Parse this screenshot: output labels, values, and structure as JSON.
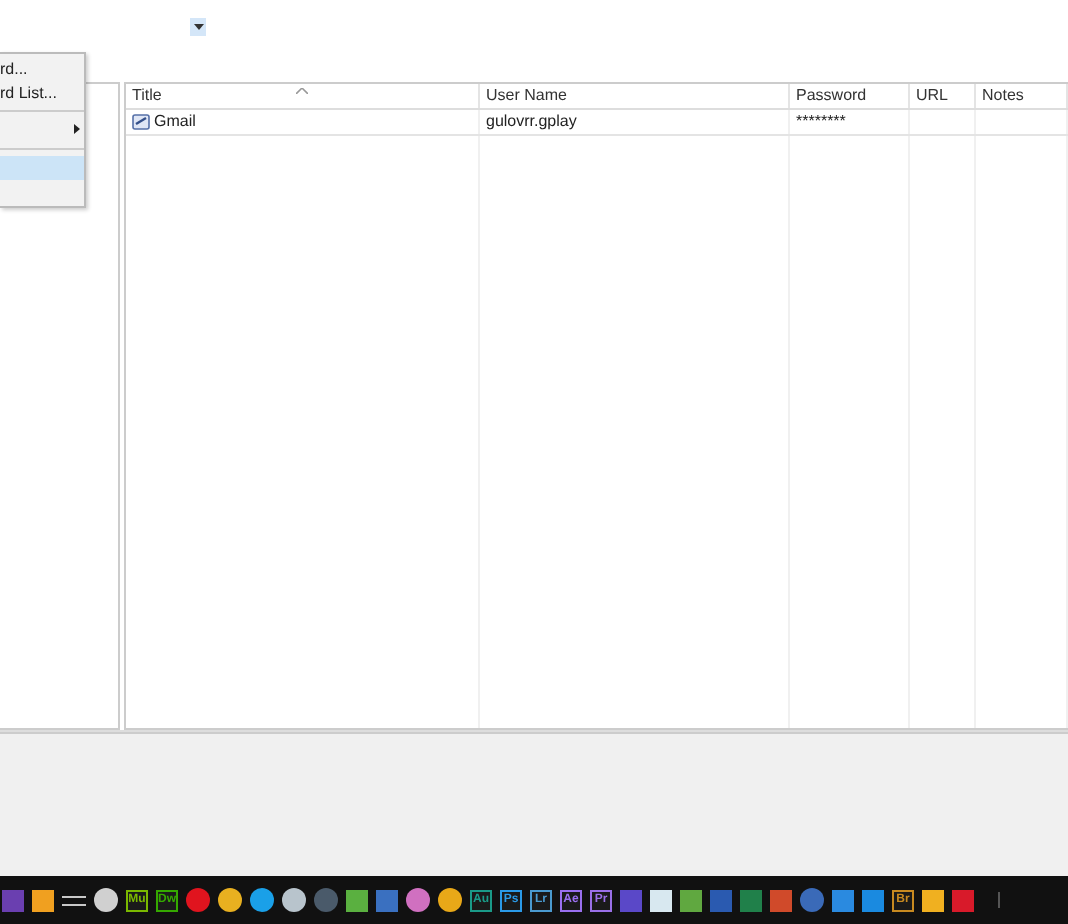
{
  "menu": {
    "items": [
      {
        "kind": "item",
        "label": "rd...",
        "selected": false
      },
      {
        "kind": "item",
        "label": "rd List...",
        "selected": false
      },
      {
        "kind": "separator"
      },
      {
        "kind": "submenu",
        "selected": false
      },
      {
        "kind": "separator"
      },
      {
        "kind": "item",
        "selected": true
      },
      {
        "kind": "item",
        "selected": false
      }
    ]
  },
  "entries": {
    "columns": [
      {
        "label": "Title",
        "sorted": true
      },
      {
        "label": "User Name",
        "sorted": false
      },
      {
        "label": "Password",
        "sorted": false
      },
      {
        "label": "URL",
        "sorted": false
      },
      {
        "label": "Notes",
        "sorted": false
      }
    ],
    "rows": [
      {
        "cells": [
          "Gmail",
          "gulovrr.gplay",
          "********",
          "",
          ""
        ]
      }
    ]
  },
  "taskbar": {
    "items": [
      {
        "kind": "tile",
        "color": "#6a3fb0"
      },
      {
        "kind": "tile",
        "color": "#f0a020"
      },
      {
        "kind": "glyph",
        "color": "#c8c8c8"
      },
      {
        "kind": "circle",
        "color": "#d0d0d0"
      },
      {
        "kind": "tile",
        "label": "Mu",
        "color": "#7ab800"
      },
      {
        "kind": "tile",
        "label": "Dw",
        "color": "#35a800"
      },
      {
        "kind": "circle",
        "color": "#e0141e"
      },
      {
        "kind": "circle",
        "color": "#e8b020"
      },
      {
        "kind": "circle",
        "color": "#1aa0e8"
      },
      {
        "kind": "circle",
        "color": "#b8c4cc"
      },
      {
        "kind": "circle",
        "color": "#4a5a6a"
      },
      {
        "kind": "tile",
        "color": "#5ab040"
      },
      {
        "kind": "tile",
        "color": "#3a70c0"
      },
      {
        "kind": "circle",
        "color": "#d070c0"
      },
      {
        "kind": "circle",
        "color": "#e8a818"
      },
      {
        "kind": "tile",
        "label": "Au",
        "color": "#1a9a88"
      },
      {
        "kind": "tile",
        "label": "Ps",
        "color": "#2a9ae8"
      },
      {
        "kind": "tile",
        "label": "Lr",
        "color": "#4a9ad0"
      },
      {
        "kind": "tile",
        "label": "Ae",
        "color": "#9a70f0"
      },
      {
        "kind": "tile",
        "label": "Pr",
        "color": "#9a70e8"
      },
      {
        "kind": "tile",
        "color": "#5a48c8"
      },
      {
        "kind": "tile",
        "color": "#d8e8f0"
      },
      {
        "kind": "tile",
        "color": "#60a840"
      },
      {
        "kind": "tile",
        "color": "#2a5ab0"
      },
      {
        "kind": "tile",
        "color": "#20804a"
      },
      {
        "kind": "tile",
        "color": "#d04a2a"
      },
      {
        "kind": "circle",
        "color": "#3a6ab8"
      },
      {
        "kind": "tile",
        "color": "#2a8ae0"
      },
      {
        "kind": "tile",
        "color": "#1a8ae0"
      },
      {
        "kind": "tile",
        "label": "Br",
        "color": "#c88a20"
      },
      {
        "kind": "tile",
        "color": "#f0b020"
      },
      {
        "kind": "tile",
        "color": "#d81a2a"
      }
    ]
  }
}
